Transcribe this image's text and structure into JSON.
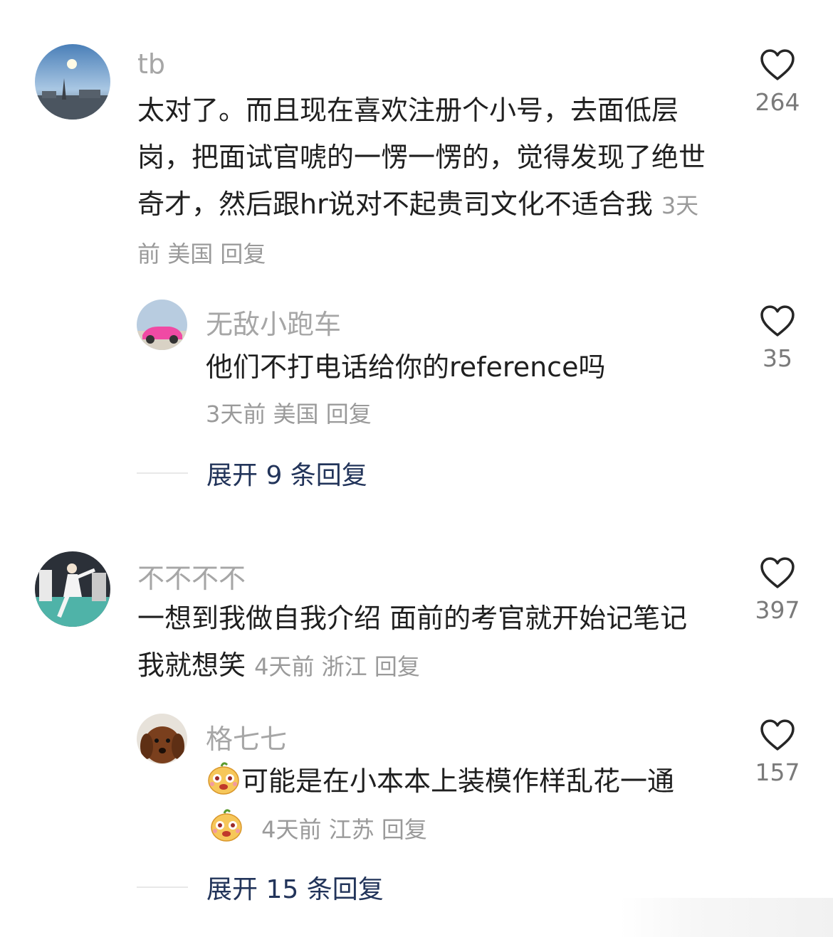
{
  "comments": [
    {
      "username": "tb",
      "text": "太对了。而且现在喜欢注册个小号，去面低层岗，把面试官唬的一愣一愣的，觉得发现了绝世奇才，然后跟hr说对不起贵司文化不适合我",
      "time": "3天前",
      "location": "美国",
      "reply_label": "回复",
      "likes": "264",
      "replies": [
        {
          "username": "无敌小跑车",
          "text": "他们不打电话给你的reference吗",
          "time": "3天前",
          "location": "美国",
          "reply_label": "回复",
          "likes": "35"
        }
      ],
      "expand_label": "展开 9 条回复"
    },
    {
      "username": "不不不不",
      "text": "一想到我做自我介绍 面前的考官就开始记笔记 我就想笑",
      "time": "4天前",
      "location": "浙江",
      "reply_label": "回复",
      "likes": "397",
      "replies": [
        {
          "username": "格七七",
          "text_before": "可能是在小本本上装模作样乱花一通",
          "time": "4天前",
          "location": "江苏",
          "reply_label": "回复",
          "likes": "157",
          "emoji": "sticker-face-icon"
        }
      ],
      "expand_label": "展开 15 条回复"
    }
  ]
}
